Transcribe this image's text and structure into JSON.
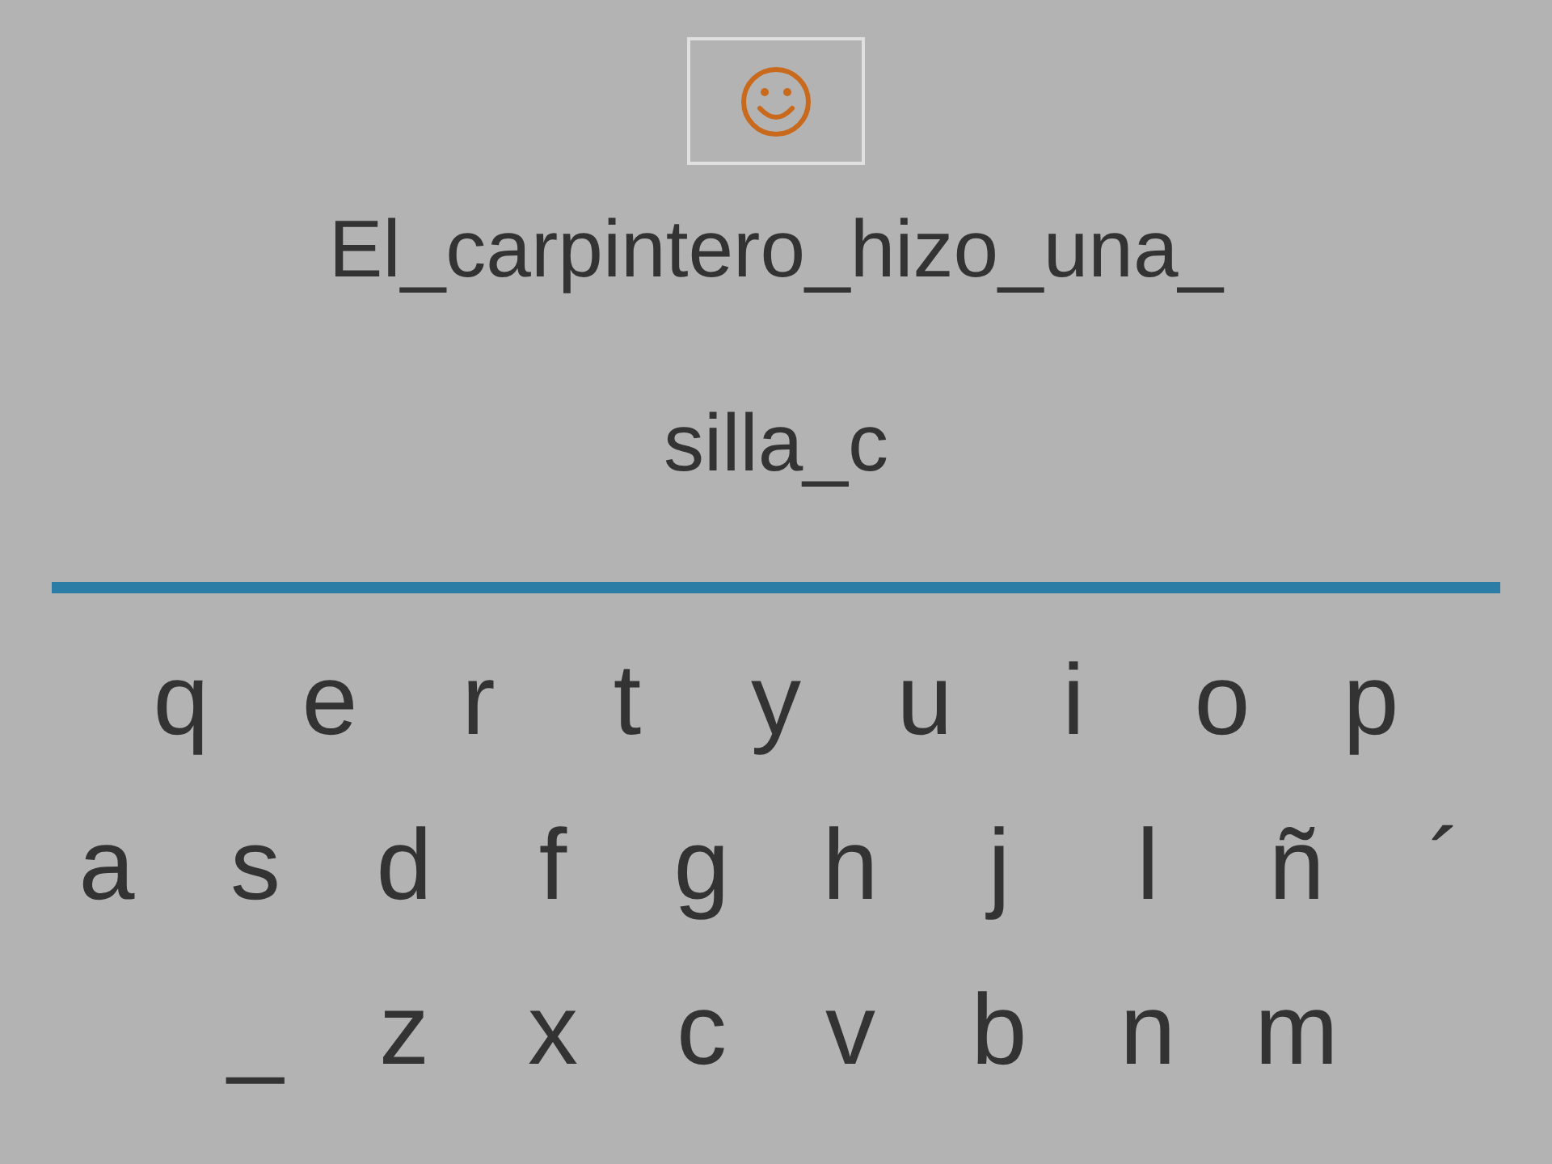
{
  "sentence_lines": [
    "El_carpintero_hizo_una_",
    "silla_c"
  ],
  "keyboard_rows": [
    [
      "q",
      "e",
      "r",
      "t",
      "y",
      "u",
      "i",
      "o",
      "p"
    ],
    [
      "a",
      "s",
      "d",
      "f",
      "g",
      "h",
      "j",
      "l",
      "ñ",
      "´"
    ],
    [
      "_",
      "z",
      "x",
      "c",
      "v",
      "b",
      "n",
      "m"
    ]
  ]
}
